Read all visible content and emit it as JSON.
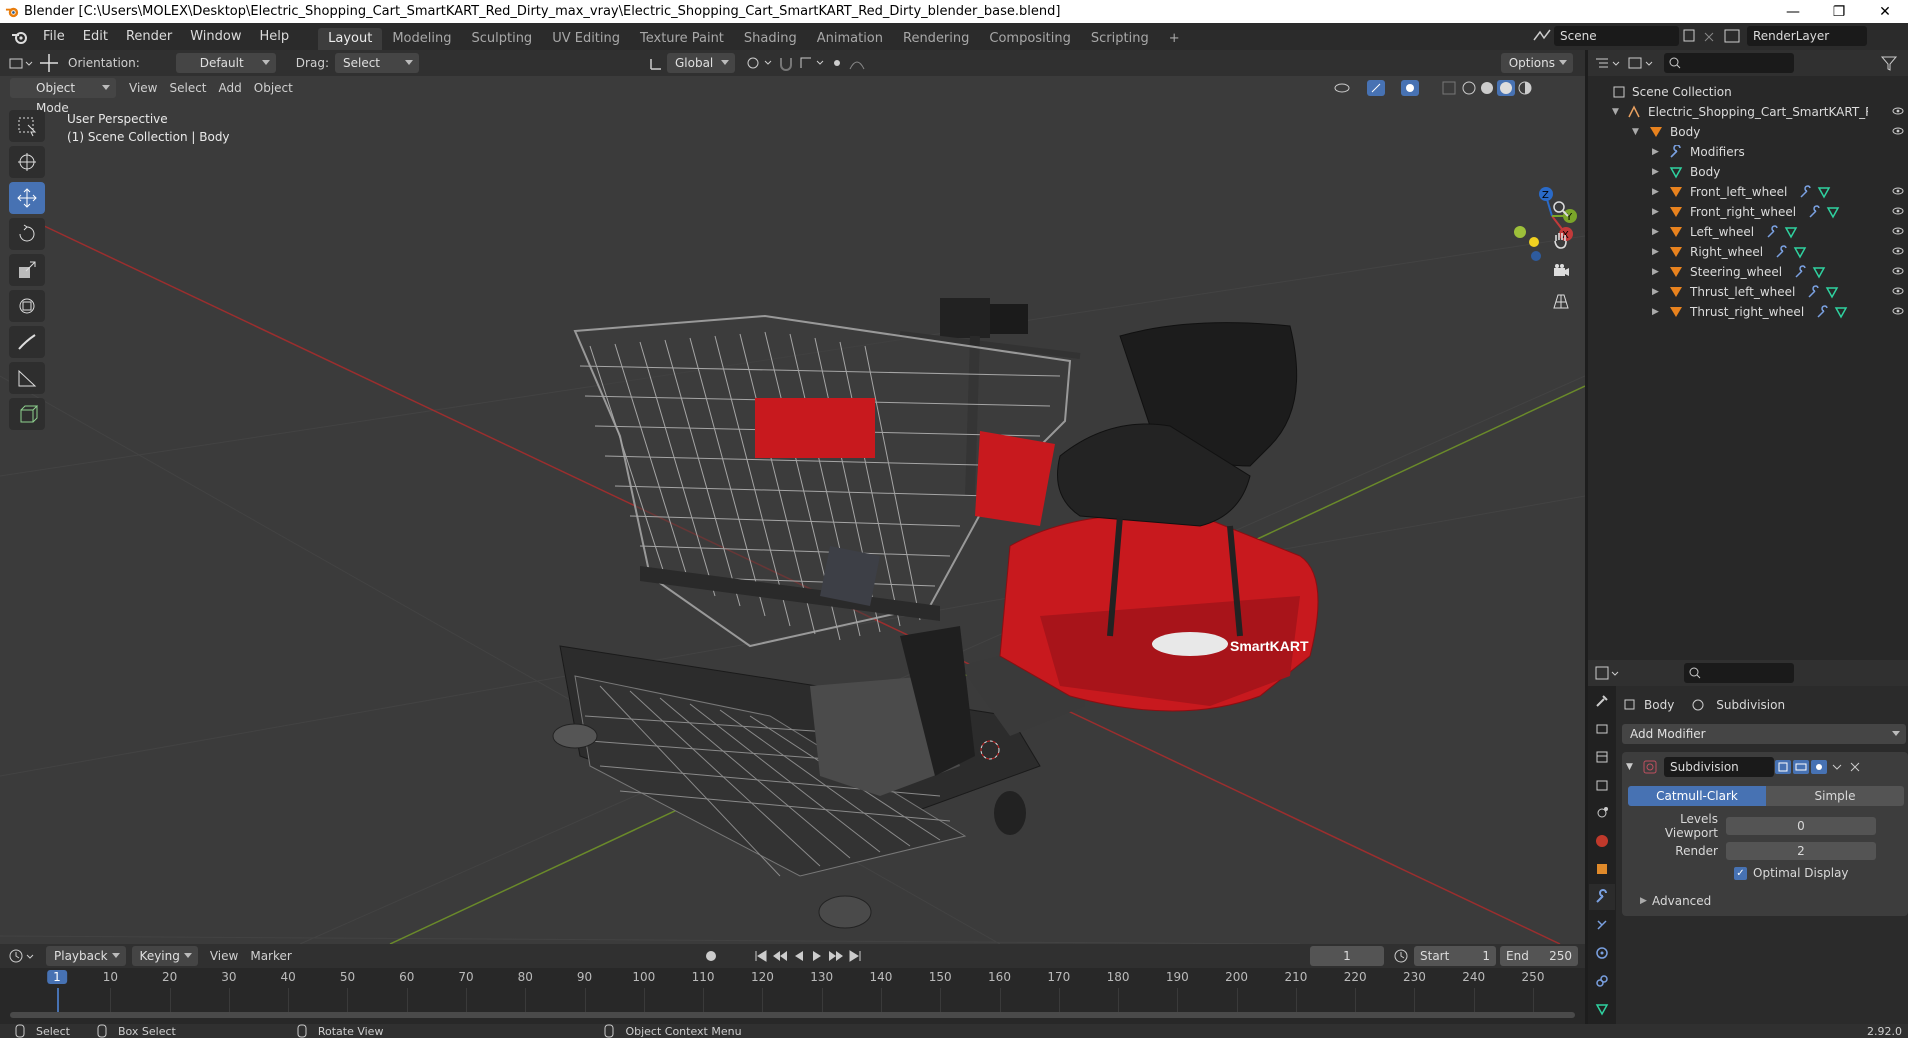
{
  "window": {
    "title": "Blender [C:\\Users\\MOLEX\\Desktop\\Electric_Shopping_Cart_SmartKART_Red_Dirty_max_vray\\Electric_Shopping_Cart_SmartKART_Red_Dirty_blender_base.blend]",
    "min": "—",
    "restore": "❐",
    "close": "✕"
  },
  "menu": [
    "File",
    "Edit",
    "Render",
    "Window",
    "Help"
  ],
  "workspaces": [
    "Layout",
    "Modeling",
    "Sculpting",
    "UV Editing",
    "Texture Paint",
    "Shading",
    "Animation",
    "Rendering",
    "Compositing",
    "Scripting"
  ],
  "workspace_add": "+",
  "scene": {
    "name": "Scene",
    "renderlayer": "RenderLayer"
  },
  "header": {
    "orientation_label": "Orientation:",
    "orientation_value": "Default",
    "drag_label": "Drag:",
    "drag_value": "Select Box",
    "transform": "Global",
    "options": "Options"
  },
  "viewport_header": {
    "mode": "Object Mode",
    "menus": [
      "View",
      "Select",
      "Add",
      "Object"
    ]
  },
  "viewport": {
    "line1": "User Perspective",
    "line2": "(1) Scene Collection | Body",
    "gizmo": {
      "x": "X",
      "y": "Y",
      "z": "Z"
    },
    "logo_text": "SmartKART"
  },
  "outliner": {
    "root": "Scene Collection",
    "collection": "Electric_Shopping_Cart_SmartKART_Red_Dir",
    "items": [
      {
        "label": "Body",
        "level": 1
      },
      {
        "label": "Modifiers",
        "level": 2
      },
      {
        "label": "Body",
        "level": 2
      },
      {
        "label": "Front_left_wheel",
        "level": 2
      },
      {
        "label": "Front_right_wheel",
        "level": 2
      },
      {
        "label": "Left_wheel",
        "level": 2
      },
      {
        "label": "Right_wheel",
        "level": 2
      },
      {
        "label": "Steering_wheel",
        "level": 2
      },
      {
        "label": "Thrust_left_wheel",
        "level": 2
      },
      {
        "label": "Thrust_right_wheel",
        "level": 2
      }
    ]
  },
  "properties": {
    "object": "Body",
    "modifier_crumb": "Subdivision",
    "add_modifier": "Add Modifier",
    "modifier_name": "Subdivision",
    "type_a": "Catmull-Clark",
    "type_b": "Simple",
    "levels_viewport_label": "Levels Viewport",
    "levels_viewport_value": "0",
    "render_label": "Render",
    "render_value": "2",
    "optimal_display": "Optimal Display",
    "advanced": "Advanced"
  },
  "timeline": {
    "menus": [
      "Playback",
      "Keying",
      "View",
      "Marker"
    ],
    "current_frame": "1",
    "start_label": "Start",
    "start_value": "1",
    "end_label": "End",
    "end_value": "250",
    "ticks": [
      "1",
      "10",
      "20",
      "30",
      "40",
      "50",
      "60",
      "70",
      "80",
      "90",
      "100",
      "110",
      "120",
      "130",
      "140",
      "150",
      "160",
      "170",
      "180",
      "190",
      "200",
      "210",
      "220",
      "230",
      "240",
      "250"
    ]
  },
  "status": {
    "select": "Select",
    "box_select": "Box Select",
    "rotate_view": "Rotate View",
    "context_menu": "Object Context Menu",
    "version": "2.92.0"
  },
  "colors": {
    "accent": "#4772b3",
    "axis_x": "#9b2e2e",
    "axis_y": "#6a8a2a",
    "cart_red": "#c8191e"
  }
}
